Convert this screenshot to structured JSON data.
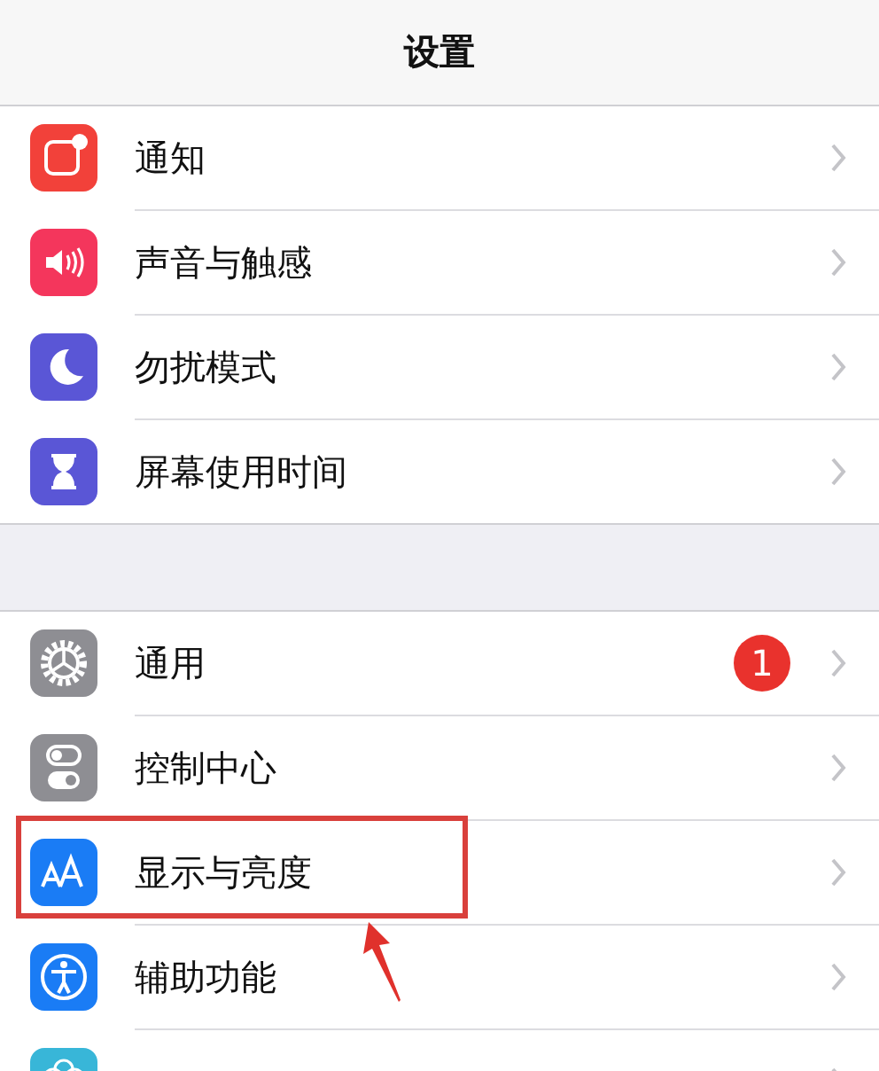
{
  "navigation_bar": {
    "title": "设置"
  },
  "groups": [
    {
      "items": [
        {
          "label": "通知",
          "kind": "notifications",
          "color": "#f2413a",
          "highlighted": false
        },
        {
          "label": "声音与触感",
          "kind": "sound",
          "color": "#f4365c",
          "highlighted": false
        },
        {
          "label": "勿扰模式",
          "kind": "moon",
          "color": "#5a56d6",
          "highlighted": false
        },
        {
          "label": "屏幕使用时间",
          "kind": "hourglass",
          "color": "#5a56d6",
          "highlighted": false
        }
      ]
    },
    {
      "items": [
        {
          "label": "通用",
          "kind": "gear",
          "color": "#8e8e93",
          "badge": "1",
          "highlighted": false
        },
        {
          "label": "控制中心",
          "kind": "toggles",
          "color": "#8e8e93",
          "highlighted": false
        },
        {
          "label": "显示与亮度",
          "kind": "text-size",
          "color": "#1a7cf5",
          "highlighted": true
        },
        {
          "label": "辅助功能",
          "kind": "accessibility",
          "color": "#1a7cf5",
          "highlighted": false
        },
        {
          "kind": "flower",
          "color": "#38b6d8",
          "highlighted": false
        }
      ]
    }
  ]
}
